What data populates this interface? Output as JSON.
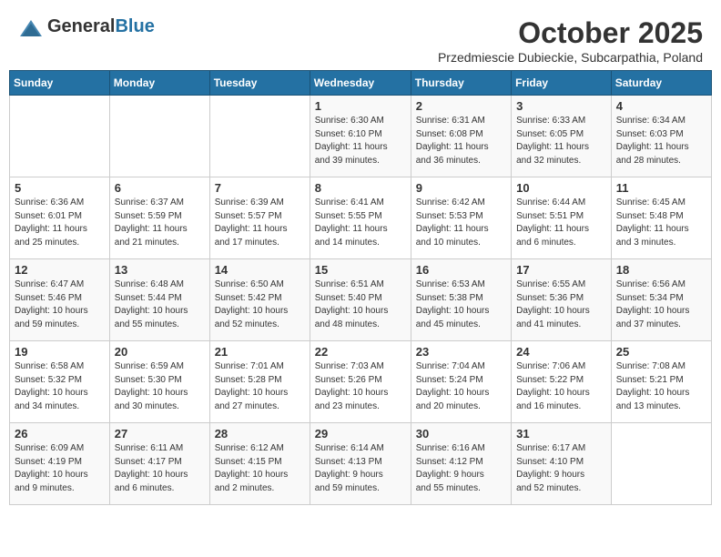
{
  "header": {
    "logo_general": "General",
    "logo_blue": "Blue",
    "month": "October 2025",
    "subtitle": "Przedmiescie Dubieckie, Subcarpathia, Poland"
  },
  "weekdays": [
    "Sunday",
    "Monday",
    "Tuesday",
    "Wednesday",
    "Thursday",
    "Friday",
    "Saturday"
  ],
  "weeks": [
    [
      {
        "day": "",
        "info": ""
      },
      {
        "day": "",
        "info": ""
      },
      {
        "day": "",
        "info": ""
      },
      {
        "day": "1",
        "info": "Sunrise: 6:30 AM\nSunset: 6:10 PM\nDaylight: 11 hours\nand 39 minutes."
      },
      {
        "day": "2",
        "info": "Sunrise: 6:31 AM\nSunset: 6:08 PM\nDaylight: 11 hours\nand 36 minutes."
      },
      {
        "day": "3",
        "info": "Sunrise: 6:33 AM\nSunset: 6:05 PM\nDaylight: 11 hours\nand 32 minutes."
      },
      {
        "day": "4",
        "info": "Sunrise: 6:34 AM\nSunset: 6:03 PM\nDaylight: 11 hours\nand 28 minutes."
      }
    ],
    [
      {
        "day": "5",
        "info": "Sunrise: 6:36 AM\nSunset: 6:01 PM\nDaylight: 11 hours\nand 25 minutes."
      },
      {
        "day": "6",
        "info": "Sunrise: 6:37 AM\nSunset: 5:59 PM\nDaylight: 11 hours\nand 21 minutes."
      },
      {
        "day": "7",
        "info": "Sunrise: 6:39 AM\nSunset: 5:57 PM\nDaylight: 11 hours\nand 17 minutes."
      },
      {
        "day": "8",
        "info": "Sunrise: 6:41 AM\nSunset: 5:55 PM\nDaylight: 11 hours\nand 14 minutes."
      },
      {
        "day": "9",
        "info": "Sunrise: 6:42 AM\nSunset: 5:53 PM\nDaylight: 11 hours\nand 10 minutes."
      },
      {
        "day": "10",
        "info": "Sunrise: 6:44 AM\nSunset: 5:51 PM\nDaylight: 11 hours\nand 6 minutes."
      },
      {
        "day": "11",
        "info": "Sunrise: 6:45 AM\nSunset: 5:48 PM\nDaylight: 11 hours\nand 3 minutes."
      }
    ],
    [
      {
        "day": "12",
        "info": "Sunrise: 6:47 AM\nSunset: 5:46 PM\nDaylight: 10 hours\nand 59 minutes."
      },
      {
        "day": "13",
        "info": "Sunrise: 6:48 AM\nSunset: 5:44 PM\nDaylight: 10 hours\nand 55 minutes."
      },
      {
        "day": "14",
        "info": "Sunrise: 6:50 AM\nSunset: 5:42 PM\nDaylight: 10 hours\nand 52 minutes."
      },
      {
        "day": "15",
        "info": "Sunrise: 6:51 AM\nSunset: 5:40 PM\nDaylight: 10 hours\nand 48 minutes."
      },
      {
        "day": "16",
        "info": "Sunrise: 6:53 AM\nSunset: 5:38 PM\nDaylight: 10 hours\nand 45 minutes."
      },
      {
        "day": "17",
        "info": "Sunrise: 6:55 AM\nSunset: 5:36 PM\nDaylight: 10 hours\nand 41 minutes."
      },
      {
        "day": "18",
        "info": "Sunrise: 6:56 AM\nSunset: 5:34 PM\nDaylight: 10 hours\nand 37 minutes."
      }
    ],
    [
      {
        "day": "19",
        "info": "Sunrise: 6:58 AM\nSunset: 5:32 PM\nDaylight: 10 hours\nand 34 minutes."
      },
      {
        "day": "20",
        "info": "Sunrise: 6:59 AM\nSunset: 5:30 PM\nDaylight: 10 hours\nand 30 minutes."
      },
      {
        "day": "21",
        "info": "Sunrise: 7:01 AM\nSunset: 5:28 PM\nDaylight: 10 hours\nand 27 minutes."
      },
      {
        "day": "22",
        "info": "Sunrise: 7:03 AM\nSunset: 5:26 PM\nDaylight: 10 hours\nand 23 minutes."
      },
      {
        "day": "23",
        "info": "Sunrise: 7:04 AM\nSunset: 5:24 PM\nDaylight: 10 hours\nand 20 minutes."
      },
      {
        "day": "24",
        "info": "Sunrise: 7:06 AM\nSunset: 5:22 PM\nDaylight: 10 hours\nand 16 minutes."
      },
      {
        "day": "25",
        "info": "Sunrise: 7:08 AM\nSunset: 5:21 PM\nDaylight: 10 hours\nand 13 minutes."
      }
    ],
    [
      {
        "day": "26",
        "info": "Sunrise: 6:09 AM\nSunset: 4:19 PM\nDaylight: 10 hours\nand 9 minutes."
      },
      {
        "day": "27",
        "info": "Sunrise: 6:11 AM\nSunset: 4:17 PM\nDaylight: 10 hours\nand 6 minutes."
      },
      {
        "day": "28",
        "info": "Sunrise: 6:12 AM\nSunset: 4:15 PM\nDaylight: 10 hours\nand 2 minutes."
      },
      {
        "day": "29",
        "info": "Sunrise: 6:14 AM\nSunset: 4:13 PM\nDaylight: 9 hours\nand 59 minutes."
      },
      {
        "day": "30",
        "info": "Sunrise: 6:16 AM\nSunset: 4:12 PM\nDaylight: 9 hours\nand 55 minutes."
      },
      {
        "day": "31",
        "info": "Sunrise: 6:17 AM\nSunset: 4:10 PM\nDaylight: 9 hours\nand 52 minutes."
      },
      {
        "day": "",
        "info": ""
      }
    ]
  ]
}
